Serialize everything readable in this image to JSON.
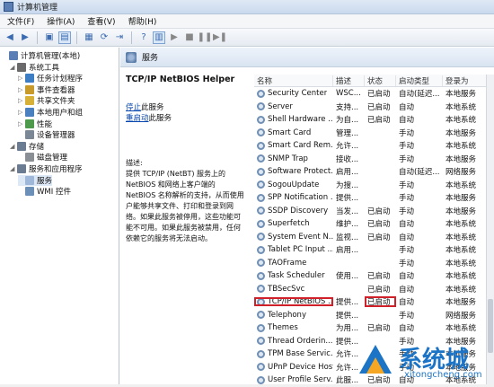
{
  "window": {
    "title": "计算机管理"
  },
  "menu": [
    "文件(F)",
    "操作(A)",
    "查看(V)",
    "帮助(H)"
  ],
  "tree": {
    "items": [
      {
        "label": "计算机管理(本地)",
        "level": 0,
        "arrow": ""
      },
      {
        "label": "系统工具",
        "level": 1,
        "arrow": "◢"
      },
      {
        "label": "任务计划程序",
        "level": 2,
        "arrow": "▷"
      },
      {
        "label": "事件查看器",
        "level": 2,
        "arrow": "▷"
      },
      {
        "label": "共享文件夹",
        "level": 2,
        "arrow": "▷"
      },
      {
        "label": "本地用户和组",
        "level": 2,
        "arrow": "▷"
      },
      {
        "label": "性能",
        "level": 2,
        "arrow": "▷"
      },
      {
        "label": "设备管理器",
        "level": 2,
        "arrow": ""
      },
      {
        "label": "存储",
        "level": 1,
        "arrow": "◢"
      },
      {
        "label": "磁盘管理",
        "level": 2,
        "arrow": ""
      },
      {
        "label": "服务和应用程序",
        "level": 1,
        "arrow": "◢"
      },
      {
        "label": "服务",
        "level": 2,
        "arrow": "",
        "selected": true
      },
      {
        "label": "WMI 控件",
        "level": 2,
        "arrow": ""
      }
    ]
  },
  "main": {
    "header": "服务",
    "detail": {
      "title": "TCP/IP NetBIOS Helper",
      "stop_link": "停止",
      "stop_suffix": "此服务",
      "restart_link": "重启动",
      "restart_suffix": "此服务",
      "desc_label": "描述:",
      "desc_lines": [
        "提供 TCP/IP (NetBT) 服务上的",
        "NetBIOS 和网络上客户端的",
        "NetBIOS 名称解析的支持，从而使用",
        "户能够共享文件、打印和登录到网",
        "络。如果此服务被停用，这些功能可",
        "能不可用。如果此服务被禁用，任何",
        "依赖它的服务将无法启动。"
      ]
    },
    "table": {
      "columns": [
        "名称",
        "描述",
        "状态",
        "启动类型",
        "登录为"
      ],
      "rows": [
        [
          "Security Center",
          "WSC...",
          "已启动",
          "自动(延迟...",
          "本地服务"
        ],
        [
          "Server",
          "支持...",
          "已启动",
          "自动",
          "本地系统"
        ],
        [
          "Shell Hardware ...",
          "为自...",
          "已启动",
          "自动",
          "本地系统"
        ],
        [
          "Smart Card",
          "管理...",
          "",
          "手动",
          "本地服务"
        ],
        [
          "Smart Card Rem...",
          "允许...",
          "",
          "手动",
          "本地系统"
        ],
        [
          "SNMP Trap",
          "接收...",
          "",
          "手动",
          "本地服务"
        ],
        [
          "Software Protect...",
          "启用...",
          "",
          "自动(延迟...",
          "网络服务"
        ],
        [
          "SogouUpdate",
          "为搜...",
          "",
          "手动",
          "本地系统"
        ],
        [
          "SPP Notification ...",
          "提供...",
          "",
          "手动",
          "本地服务"
        ],
        [
          "SSDP Discovery",
          "当发...",
          "已启动",
          "手动",
          "本地服务"
        ],
        [
          "Superfetch",
          "维护...",
          "已启动",
          "自动",
          "本地系统"
        ],
        [
          "System Event N...",
          "监视...",
          "已启动",
          "自动",
          "本地系统"
        ],
        [
          "Tablet PC Input ...",
          "启用...",
          "",
          "手动",
          "本地系统"
        ],
        [
          "TAOFrame",
          "",
          "",
          "手动",
          "本地系统"
        ],
        [
          "Task Scheduler",
          "使用...",
          "已启动",
          "自动",
          "本地系统"
        ],
        [
          "TBSecSvc",
          "",
          "已启动",
          "自动",
          "本地系统"
        ],
        [
          "TCP/IP NetBIOS ...",
          "提供...",
          "已启动",
          "自动",
          "本地服务"
        ],
        [
          "Telephony",
          "提供...",
          "",
          "手动",
          "网络服务"
        ],
        [
          "Themes",
          "为用...",
          "已启动",
          "自动",
          "本地系统"
        ],
        [
          "Thread Orderin...",
          "提供...",
          "",
          "手动",
          "本地服务"
        ],
        [
          "TPM Base Servic...",
          "允许...",
          "",
          "手动",
          "本地服务"
        ],
        [
          "UPnP Device Host",
          "允许...",
          "",
          "手动",
          "本地服务"
        ],
        [
          "User Profile Serv...",
          "此服...",
          "已启动",
          "自动",
          "本地系统"
        ]
      ],
      "highlight_row": 16
    }
  },
  "watermark": {
    "brand": "系统城",
    "url": "xitongcheng.com"
  },
  "colors": {
    "highlight": "#d0202a",
    "link": "#0645ad",
    "watermark": "#1b74c6"
  }
}
